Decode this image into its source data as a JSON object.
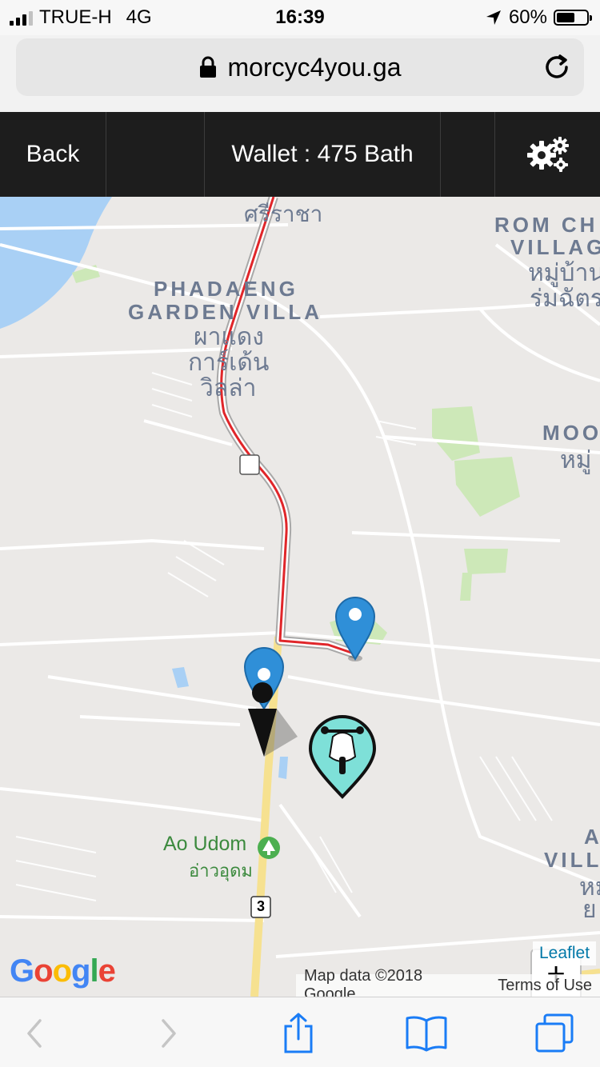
{
  "status_bar": {
    "carrier": "TRUE-H",
    "network": "4G",
    "time": "16:39",
    "battery": "60%",
    "battery_fraction": 0.6
  },
  "browser": {
    "url": "morcyc4you.ga"
  },
  "app_nav": {
    "back_label": "Back",
    "wallet_label": "Wallet : 475 Bath"
  },
  "map": {
    "labels": {
      "thai_top": "ศรีราชา",
      "phadaeng_1": "PHADAENG",
      "phadaeng_2": "GARDEN VILLA",
      "phadaeng_thai_1": "ผาแดง",
      "phadaeng_thai_2": "การ์เด้น",
      "phadaeng_thai_3": "วิลล่า",
      "rom_1": "ROM CH",
      "rom_2": "VILLAG",
      "rom_thai_1": "หมู่บ้าน",
      "rom_thai_2": "ร่มฉัตร",
      "moo": "MOO",
      "moo_thai": "หมู่",
      "ao_udom": "Ao Udom",
      "ao_udom_thai": "อ่าวอุดม",
      "right_edge_1": "AM",
      "right_edge_2": "VILL",
      "right_edge_thai": "หมู่",
      "right_edge_thai_2": "ย",
      "route_shield": "3"
    },
    "zoom_in_label": "+",
    "zoom_out_label": "−",
    "leaflet_label": "Leaflet",
    "google_logo": "Google",
    "map_data": "Map data ©2018 Google",
    "terms": "Terms of Use"
  },
  "colors": {
    "route": "#e0262a",
    "pin": "#2f8fd8",
    "moto_marker": "#7ee0d8",
    "nav_bg": "#1d1d1d"
  },
  "icons": {
    "settings": "gear-icon",
    "lock": "lock-icon",
    "reload": "reload-icon",
    "location": "location-pin-icon",
    "share": "share-icon",
    "bookmarks": "book-icon",
    "tabs": "tabs-icon"
  }
}
